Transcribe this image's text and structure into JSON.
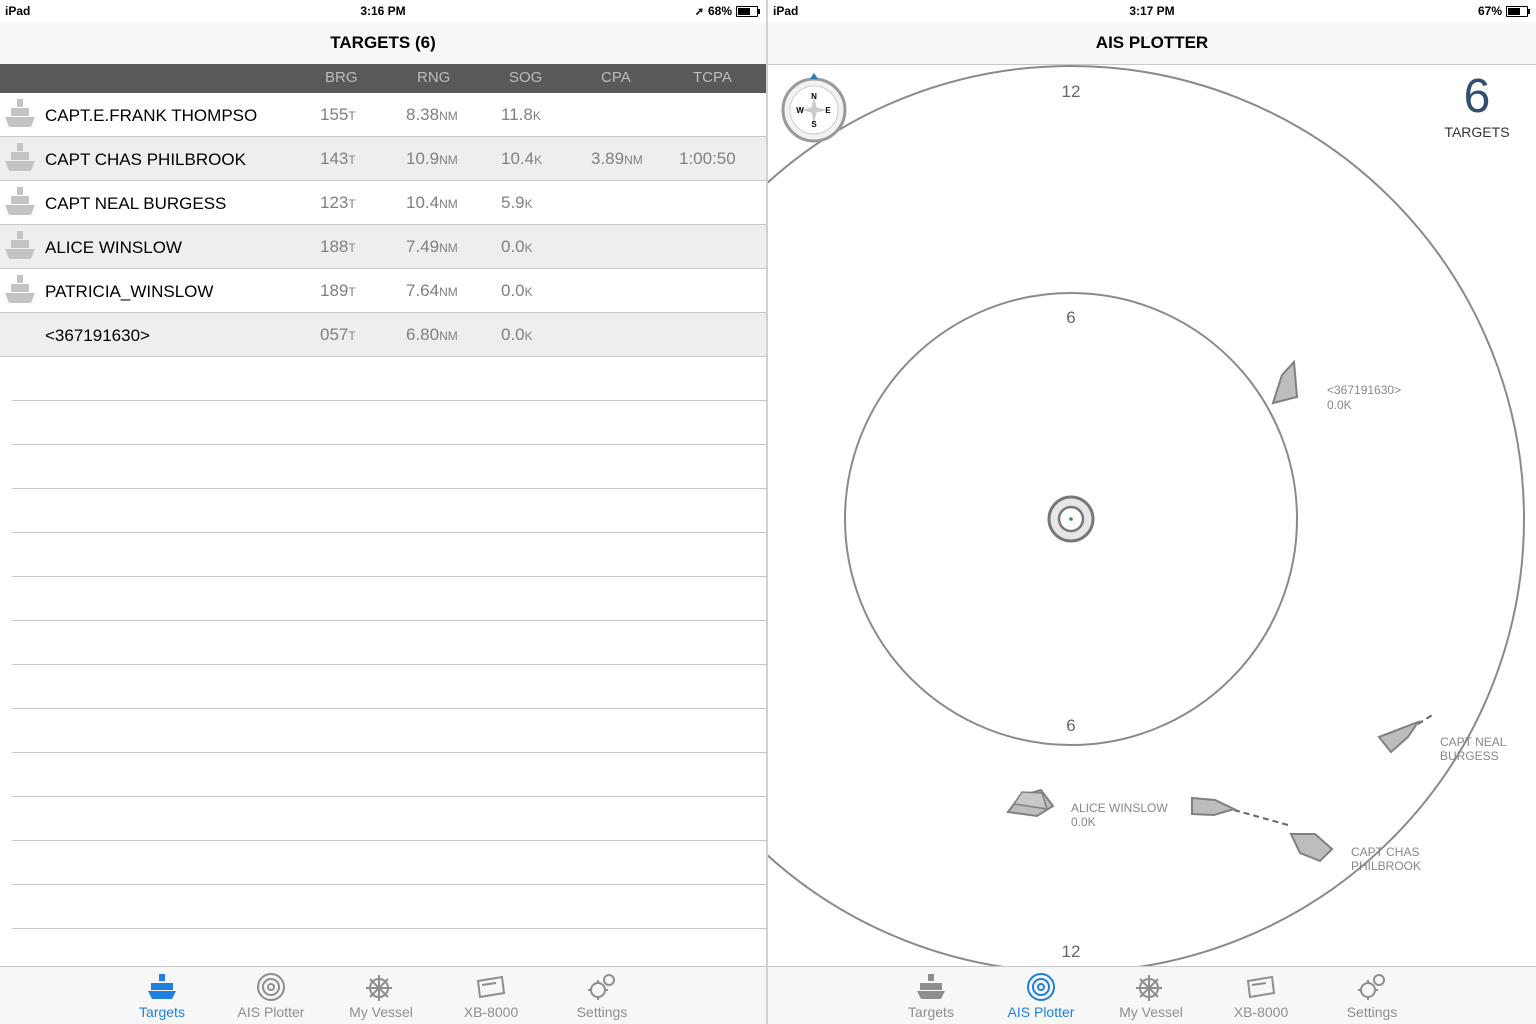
{
  "left": {
    "status": {
      "device": "iPad",
      "time": "3:16 PM",
      "battery": "68%",
      "battery_level": 0.68
    },
    "nav_title": "TARGETS (6)",
    "columns": [
      "BRG",
      "RNG",
      "SOG",
      "CPA",
      "TCPA"
    ],
    "rows": [
      {
        "name": "CAPT.E.FRANK THOMPSO",
        "brg": "155",
        "brg_unit": "T",
        "rng": "8.38",
        "rng_unit": "NM",
        "sog": "11.8",
        "sog_unit": "K",
        "cpa": "",
        "cpa_unit": "",
        "tcpa": "",
        "icon": "ship-icon"
      },
      {
        "name": "CAPT CHAS PHILBROOK",
        "brg": "143",
        "brg_unit": "T",
        "rng": "10.9",
        "rng_unit": "NM",
        "sog": "10.4",
        "sog_unit": "K",
        "cpa": "3.89",
        "cpa_unit": "NM",
        "tcpa": "1:00:50",
        "icon": "ship-icon"
      },
      {
        "name": "CAPT NEAL BURGESS",
        "brg": "123",
        "brg_unit": "T",
        "rng": "10.4",
        "rng_unit": "NM",
        "sog": "5.9",
        "sog_unit": "K",
        "cpa": "",
        "cpa_unit": "",
        "tcpa": "",
        "icon": "ship-icon"
      },
      {
        "name": "ALICE WINSLOW",
        "brg": "188",
        "brg_unit": "T",
        "rng": "7.49",
        "rng_unit": "NM",
        "sog": "0.0",
        "sog_unit": "K",
        "cpa": "",
        "cpa_unit": "",
        "tcpa": "",
        "icon": "ship-icon"
      },
      {
        "name": "PATRICIA_WINSLOW",
        "brg": "189",
        "brg_unit": "T",
        "rng": "7.64",
        "rng_unit": "NM",
        "sog": "0.0",
        "sog_unit": "K",
        "cpa": "",
        "cpa_unit": "",
        "tcpa": "",
        "icon": "ship-icon"
      },
      {
        "name": "<367191630>",
        "brg": "057",
        "brg_unit": "T",
        "rng": "6.80",
        "rng_unit": "NM",
        "sog": "0.0",
        "sog_unit": "K",
        "cpa": "",
        "cpa_unit": "",
        "tcpa": "",
        "icon": ""
      }
    ]
  },
  "right": {
    "status": {
      "device": "iPad",
      "time": "3:17 PM",
      "battery": "67%",
      "battery_level": 0.67
    },
    "nav_title": "AIS PLOTTER",
    "target_count": "6",
    "target_label": "TARGETS",
    "compass": {
      "n": "N",
      "s": "S",
      "e": "E",
      "w": "W"
    },
    "ring_labels": {
      "outer_top": "12",
      "inner_top": "6",
      "inner_bottom": "6",
      "outer_bottom": "12"
    },
    "targets": [
      {
        "line1": "<367191630>",
        "line2": "0.0K"
      },
      {
        "line1": "CAPT NEAL",
        "line2": "BURGESS"
      },
      {
        "line1": "ALICE WINSLOW",
        "line2": "0.0K"
      },
      {
        "line1": "CAPT CHAS",
        "line2": "PHILBROOK"
      }
    ]
  },
  "tabs": [
    "Targets",
    "AIS Plotter",
    "My Vessel",
    "XB-8000",
    "Settings"
  ],
  "colors": {
    "accent": "#1e7fe0",
    "header_bg": "#595959",
    "vessel_fill": "#bdbdbd",
    "ring": "#8a8a8a"
  }
}
